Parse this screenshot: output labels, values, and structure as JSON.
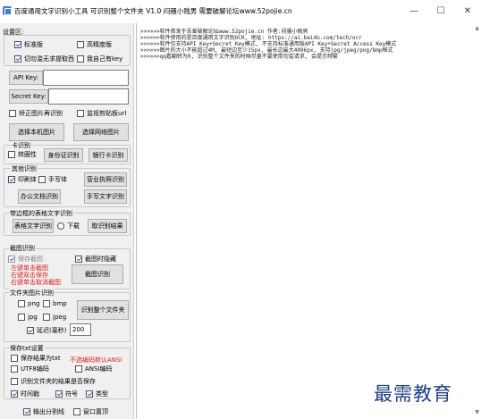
{
  "window": {
    "title": "百度通用文字识别小工具 可识别整个文件夹 V1.0  闷骚小贱男  需要破解论坛www.52pojie.cn",
    "min": "—",
    "max": "☐",
    "close": "✕"
  },
  "settings": {
    "section": "设置区:",
    "standard": "标准版",
    "high": "高精度版",
    "shortcut": "切勿滥无求提取西",
    "own_key": "我自己有key",
    "api_key_label": "API Key:",
    "secret_key_label": "Secret Key:",
    "correct_image": "矫正图片再识别",
    "monitor_clipboard": "监视剪贴板url",
    "select_local": "选择本机图片",
    "select_network": "选择网络图片"
  },
  "card": {
    "title": "卡识别",
    "plain_card": "转圈性",
    "id_card": "身份证识别",
    "bank_card": "银行卡识别"
  },
  "other": {
    "title": "其他识别",
    "print": "印刷体",
    "handwrite": "手写体",
    "business_license": "营业执照识别",
    "office_doc": "办公文档识别",
    "handwriting": "手写文字识别"
  },
  "table": {
    "title": "带边框的表格文字识别",
    "recognize": "表格文字识别",
    "download": "下载",
    "fetch": "取识别结果"
  },
  "screenshot": {
    "title": "截图识别",
    "save": "保存截图",
    "hide": "截图时隐藏",
    "hint1": "左键单击截图",
    "hint2": "右键双击保存",
    "hint3": "右键单击取消截图",
    "do": "截图识别"
  },
  "folder": {
    "title": "文件夹图片识别",
    "png": "png",
    "bmp": "bmp",
    "jpg": "jpg",
    "jpeg": "jpeg",
    "recognize": "识别整个文件夹",
    "delay_label": "延迟(毫秒)",
    "delay_value": "200"
  },
  "save": {
    "title": "保存txt设置",
    "save_txt": "保存结果为txt",
    "warn": "不选编码默认ANSI",
    "utf8": "UTF8编码",
    "ansi": "ANSI编码",
    "save_folder": "识别文件夹的结果是否保存",
    "time": "时间戳",
    "symbol": "符号",
    "type": "类型",
    "output_divider": "输出分割线",
    "topmost": "窗口置顶"
  },
  "log": [
    ">>>>>>软件首发于吾爱破解论坛www.52pojie.cn  作者:闷骚小贱男",
    ">>>>>>软件使用的是百度通用文字识别OCR, 地址: https://ai.baidu.com/tech/ocr",
    ">>>>>>软件仅支持API Key+Secret Key模式, 不支持标准通用版API Key+Secret Access Key模式",
    ">>>>>>图片的大小不能超过4M, 最短边至少15px, 最长边最大4096px, 支持jpg/jpeg/png/bmp格式",
    ">>>>>>qq看翻转为0, 识别整个文件夹的时候尽量不要使用勿滥请求, 会提示频繁"
  ],
  "watermark": "最需教育"
}
